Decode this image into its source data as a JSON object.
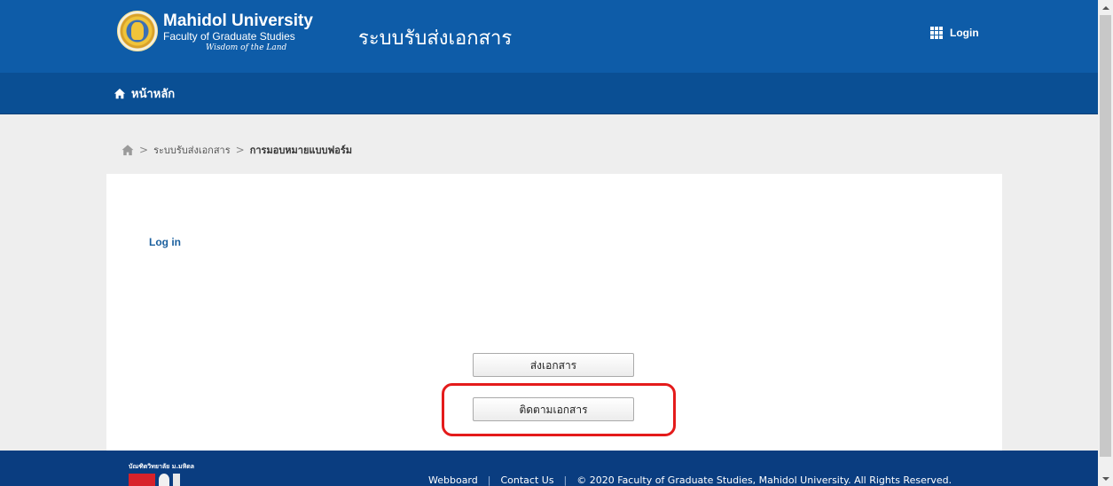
{
  "header": {
    "university_name": "Mahidol University",
    "faculty_name": "Faculty of Graduate Studies",
    "motto": "Wisdom of the Land",
    "system_title": "ระบบรับส่งเอกสาร",
    "login_label": "Login"
  },
  "nav": {
    "home_label": "หน้าหลัก"
  },
  "breadcrumb": {
    "items": [
      "ระบบรับส่งเอกสาร",
      "การมอบหมายแบบฟอร์ม"
    ]
  },
  "main": {
    "login_heading": "Log in",
    "send_button": "ส่งเอกสาร",
    "track_button": "ติดตามเอกสาร"
  },
  "footer": {
    "org_label": "บัณฑิตวิทยาลัย ม.มหิดล",
    "links": [
      "Webboard",
      "Contact Us"
    ],
    "copyright": "© 2020 Faculty of Graduate Studies, Mahidol University. All Rights Reserved."
  },
  "colors": {
    "header_blue": "#0e5ca8",
    "nav_blue": "#0a4f94",
    "footer_blue": "#0a3d80",
    "highlight_red": "#e41b1b",
    "link_blue": "#1a5f9e"
  }
}
